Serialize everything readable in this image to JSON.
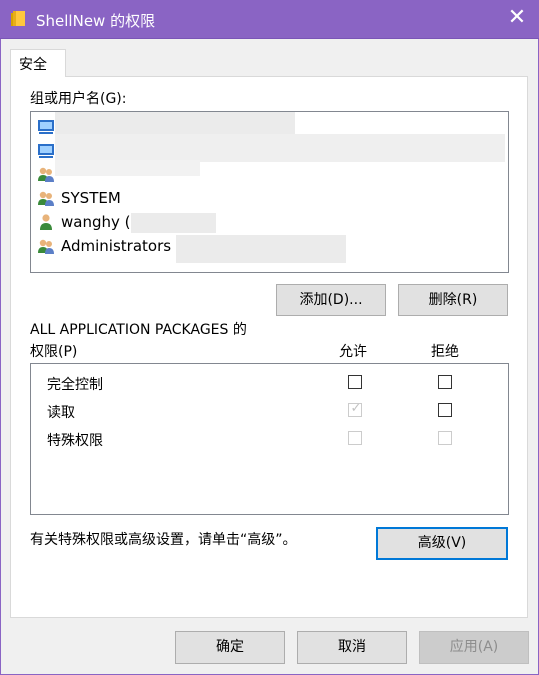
{
  "window": {
    "title": "ShellNew 的权限",
    "close_glyph": "✕",
    "accent": "#8a64c4"
  },
  "tabs": [
    {
      "label": "安全",
      "selected": true
    }
  ],
  "groups": {
    "label": "组或用户名(G):",
    "items": [
      {
        "name": "",
        "icon": "computer-icon"
      },
      {
        "name": "",
        "icon": "computer-icon"
      },
      {
        "name": "",
        "icon": "users-icon"
      },
      {
        "name": "SYSTEM",
        "icon": "users-icon"
      },
      {
        "name": "wanghy (",
        "icon": "user-icon"
      },
      {
        "name": "Administrators (",
        "icon": "users-icon"
      }
    ]
  },
  "buttons": {
    "add": "添加(D)...",
    "remove": "删除(R)",
    "advanced": "高级(V)",
    "ok": "确定",
    "cancel": "取消",
    "apply": "应用(A)"
  },
  "permissions": {
    "header_line1": "ALL APPLICATION PACKAGES 的",
    "header_line2": "权限(P)",
    "col_allow": "允许",
    "col_deny": "拒绝",
    "rows": [
      {
        "label": "完全控制",
        "allow": false,
        "deny": false,
        "enabled": true
      },
      {
        "label": "读取",
        "allow": true,
        "deny": false,
        "enabled": true,
        "allow_disabled": true
      },
      {
        "label": "特殊权限",
        "allow": false,
        "deny": false,
        "enabled": false
      }
    ]
  },
  "advanced_hint": "有关特殊权限或高级设置，请单击“高级”。"
}
